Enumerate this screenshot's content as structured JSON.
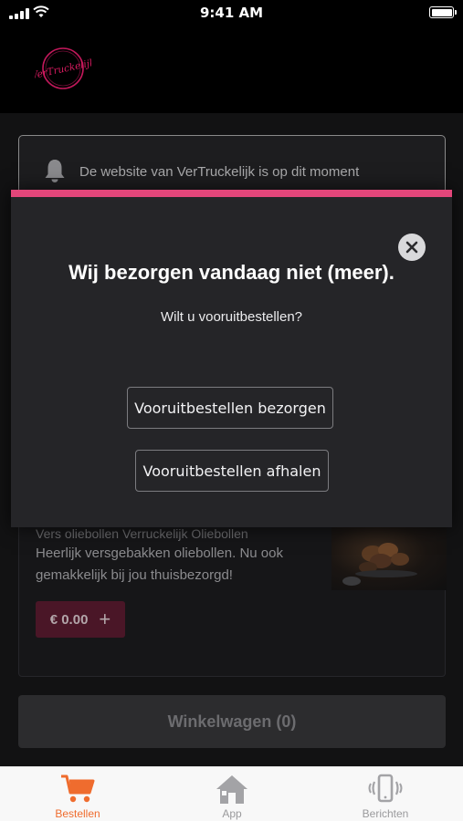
{
  "status_bar": {
    "time": "9:41 AM"
  },
  "header": {
    "logo_text": "VerTruckelijk"
  },
  "notice": {
    "text": "De website van VerTruckelijk is op dit moment",
    "icon": "bell-icon"
  },
  "product": {
    "title_partial": "Vers oliebollen Verruckelijk Oliebollen",
    "description": "Heerlijk versgebakken oliebollen. Nu ook gemakkelijk bij jou thuisbezorgd!",
    "price": "€ 0.00",
    "add_symbol": "+"
  },
  "cart": {
    "label": "Winkelwagen (0)"
  },
  "modal": {
    "title": "Wij bezorgen vandaag niet (meer).",
    "subtitle": "Wilt u vooruitbestellen?",
    "deliver_button": "Vooruitbestellen bezorgen",
    "pickup_button": "Vooruitbestellen afhalen",
    "accent_color": "#e3467a"
  },
  "tabs": [
    {
      "label": "Bestellen",
      "icon": "cart-icon",
      "active": true
    },
    {
      "label": "App",
      "icon": "home-icon",
      "active": false
    },
    {
      "label": "Berichten",
      "icon": "phone-vibrate-icon",
      "active": false
    }
  ],
  "colors": {
    "active_tab": "#ef6c2e",
    "inactive_tab": "#9a9a9c",
    "brand": "#c2185b"
  }
}
